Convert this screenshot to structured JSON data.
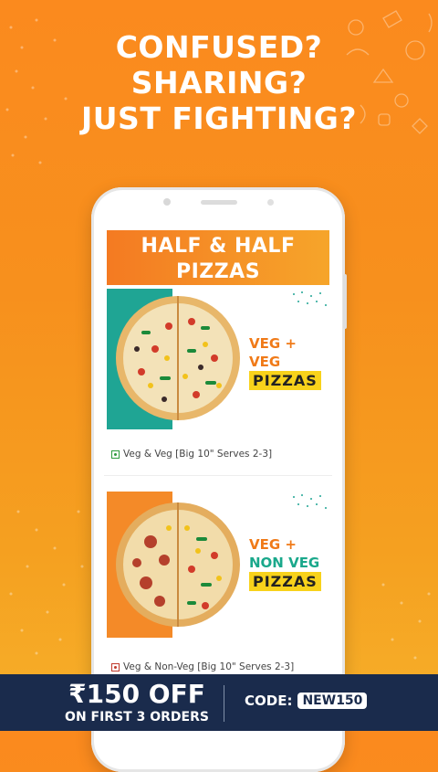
{
  "headline": {
    "line1": "CONFUSED?",
    "line2": "SHARING?",
    "line3": "JUST FIGHTING?"
  },
  "banner": {
    "line1": "HALF & HALF",
    "line2": "PIZZAS"
  },
  "cards": [
    {
      "tag_line1": "VEG + VEG",
      "tag_box": "PIZZAS",
      "caption": "Veg & Veg [Big 10\" Serves 2-3]",
      "diet": "veg"
    },
    {
      "tag_line1": "VEG +",
      "tag_line2": "NON VEG",
      "tag_box": "PIZZAS",
      "caption": "Veg & Non-Veg [Big 10\" Serves 2-3]",
      "diet": "non-veg"
    }
  ],
  "offer": {
    "amount": "₹150 OFF",
    "subtitle": "ON FIRST 3 ORDERS",
    "code_label": "CODE:",
    "code": "NEW150"
  },
  "colors": {
    "brand_orange": "#f7901d",
    "footer_navy": "#1a2b4c",
    "teal": "#1fa594",
    "tag_yellow": "#f8d21b"
  }
}
